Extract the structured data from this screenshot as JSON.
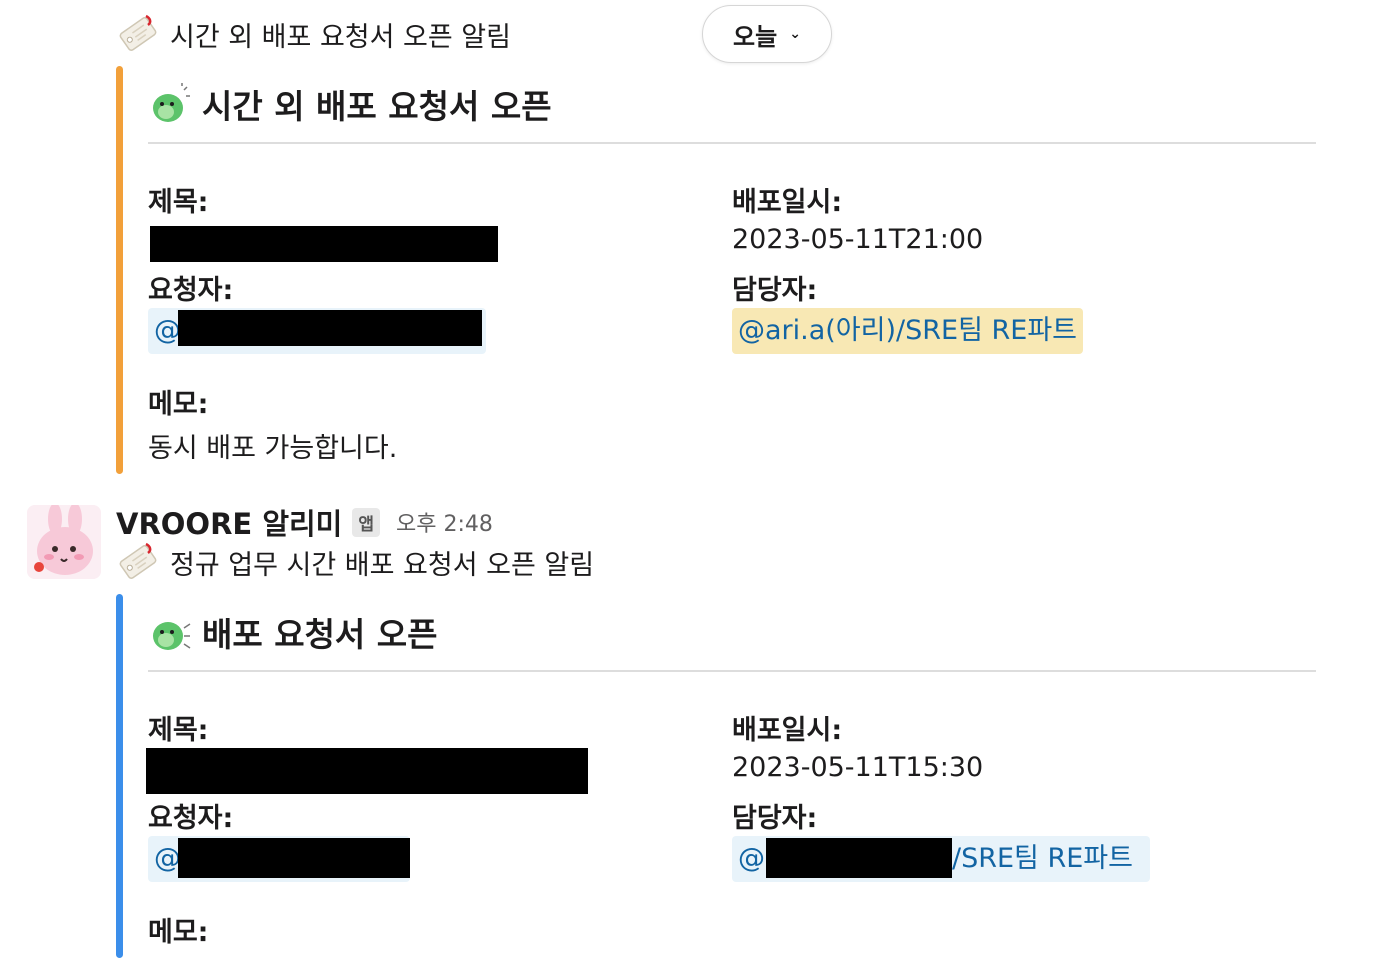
{
  "message1": {
    "intro_text": "시간 외 배포 요청서 오픈 알림",
    "attachment": {
      "accent_color": "#f2a03a",
      "header": "시간 외 배포 요청서 오픈",
      "fields": {
        "title_label": "제목:",
        "deploy_time_label": "배포일시:",
        "deploy_time_value": "2023-05-11T21:00",
        "requester_label": "요청자:",
        "requester_mention_prefix": "@",
        "assignee_label": "담당자:",
        "assignee_mention": "@ari.a(아리)/SRE팀 RE파트",
        "memo_label": "메모:",
        "memo_value": "동시 배포 가능합니다."
      }
    }
  },
  "day_divider": {
    "label": "오늘"
  },
  "message2": {
    "sender": "VROORE 알리미",
    "app_badge": "앱",
    "time": "오후 2:48",
    "intro_text": "정규 업무 시간 배포 요청서 오픈 알림",
    "attachment": {
      "accent_color": "#3b8eea",
      "header": "배포 요청서 오픈",
      "fields": {
        "title_label": "제목:",
        "deploy_time_label": "배포일시:",
        "deploy_time_value": "2023-05-11T15:30",
        "requester_label": "요청자:",
        "requester_mention_prefix": "@",
        "assignee_label": "담당자:",
        "assignee_mention_prefix": "@",
        "assignee_mention_suffix": "/SRE팀 RE파트",
        "memo_label": "메모:"
      }
    }
  },
  "icons": {
    "tag": "tag-icon",
    "mascot": "dino-mascot-icon",
    "avatar": "bunny-avatar",
    "chevron": "chevron-down-icon"
  }
}
